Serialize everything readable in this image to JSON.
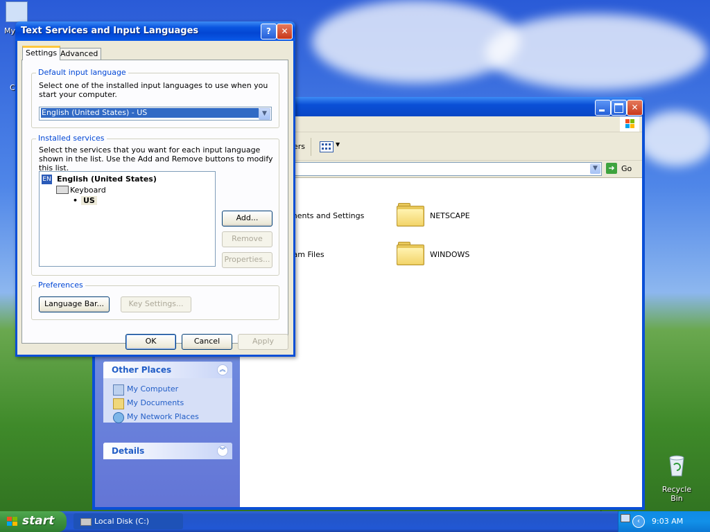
{
  "desktop": {
    "icons": [
      {
        "label": "My"
      },
      {
        "label": "C"
      },
      {
        "label": "Recycle Bin"
      }
    ]
  },
  "explorer": {
    "toolbar_partial_label": "ers",
    "address_go": "Go",
    "files": [
      {
        "name": "ments and Settings"
      },
      {
        "name": "NETSCAPE"
      },
      {
        "name": "ram Files"
      },
      {
        "name": "WINDOWS"
      }
    ],
    "other_places": {
      "title": "Other Places",
      "items": [
        "My Computer",
        "My Documents",
        "My Network Places"
      ]
    },
    "details": {
      "title": "Details"
    }
  },
  "dialog": {
    "title": "Text Services and Input Languages",
    "tabs": [
      "Settings",
      "Advanced"
    ],
    "default_input": {
      "label": "Default input language",
      "desc": "Select one of the installed input languages to use when you start your computer.",
      "selected": "English (United States) - US"
    },
    "installed": {
      "label": "Installed services",
      "desc": "Select the services that you want for each input language shown in the list. Use the Add and Remove buttons to modify this list.",
      "tree": {
        "badge": "EN",
        "language": "English (United States)",
        "category": "Keyboard",
        "layout": "US"
      },
      "buttons": {
        "add": "Add...",
        "remove": "Remove",
        "properties": "Properties..."
      }
    },
    "preferences": {
      "label": "Preferences",
      "language_bar": "Language Bar...",
      "key_settings": "Key Settings..."
    },
    "footer": {
      "ok": "OK",
      "cancel": "Cancel",
      "apply": "Apply"
    }
  },
  "taskbar": {
    "start": "start",
    "tasks": [
      "Local Disk (C:)"
    ],
    "clock": "9:03 AM"
  }
}
